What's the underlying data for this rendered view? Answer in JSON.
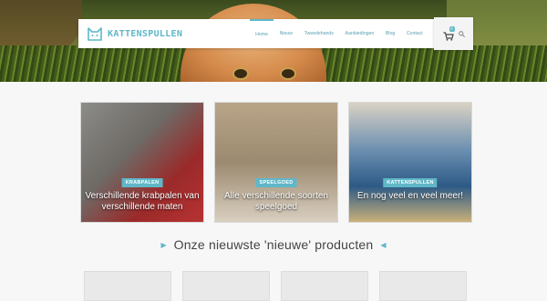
{
  "brand": {
    "name": "KATTENSPULLEN",
    "accent": "#5fb7c7"
  },
  "nav": {
    "items": [
      {
        "label": "Home",
        "active": true
      },
      {
        "label": "Nieuw",
        "active": false
      },
      {
        "label": "Tweedehands",
        "active": false
      },
      {
        "label": "Aanbiedingen",
        "active": false
      },
      {
        "label": "Blog",
        "active": false
      },
      {
        "label": "Contact",
        "active": false
      }
    ]
  },
  "cart": {
    "count": "0",
    "icon": "shopping-cart-icon"
  },
  "search": {
    "icon": "search-icon"
  },
  "categories": [
    {
      "tag": "KRABPALEN",
      "title": "Verschillende krabpalen van verschillende maten"
    },
    {
      "tag": "SPEELGOED",
      "title": "Alle verschillende soorten speelgoed"
    },
    {
      "tag": "KATTENSPULLEN",
      "title": "En nog veel en veel meer!"
    }
  ],
  "section": {
    "title": "Onze nieuwste 'nieuwe' producten"
  }
}
